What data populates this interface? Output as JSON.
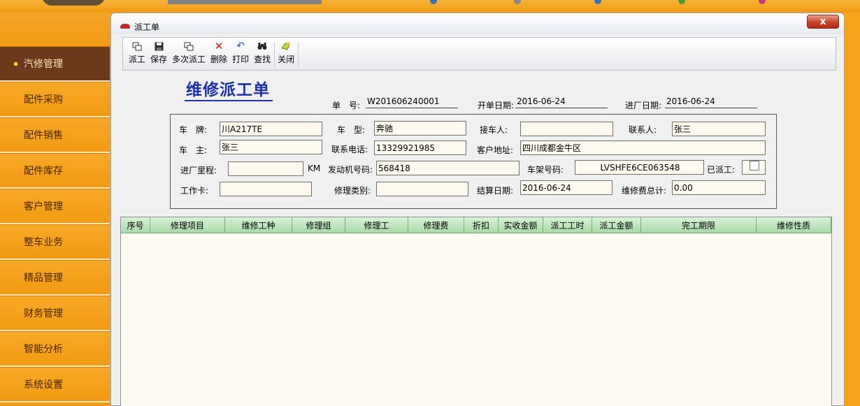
{
  "window": {
    "title": "派工单",
    "close_label": "x"
  },
  "sidebar": {
    "items": [
      {
        "label": "汽修管理",
        "active": true
      },
      {
        "label": "配件采购"
      },
      {
        "label": "配件销售"
      },
      {
        "label": "配件库存"
      },
      {
        "label": "客户管理"
      },
      {
        "label": "整车业务"
      },
      {
        "label": "精品管理"
      },
      {
        "label": "财务管理"
      },
      {
        "label": "智能分析"
      },
      {
        "label": "系统设置"
      }
    ]
  },
  "toolbar": {
    "buttons": [
      {
        "label": "派工",
        "icon": "dispatch-icon"
      },
      {
        "label": "保存",
        "icon": "save-icon"
      },
      {
        "label": "多次派工",
        "icon": "multi-dispatch-icon"
      },
      {
        "label": "删除",
        "icon": "delete-icon"
      },
      {
        "label": "打印",
        "icon": "print-icon"
      },
      {
        "label": "查找",
        "icon": "binoculars-icon"
      },
      {
        "label": "关闭",
        "icon": "close-icon"
      }
    ]
  },
  "form": {
    "heading": "维修派工单",
    "order_no_label": "单　号:",
    "order_no": "W201606240001",
    "open_date_label": "开单日期:",
    "open_date": "2016-06-24",
    "enter_date_label": "进厂日期:",
    "enter_date": "2016-06-24",
    "plate_label": "车　牌:",
    "plate": "川A217TE",
    "model_label": "车　型:",
    "model": "奔驰",
    "receiver_label": "接车人:",
    "receiver": "",
    "contact_label": "联系人:",
    "contact": "张三",
    "owner_label": "车　主:",
    "owner": "张三",
    "phone_label": "联系电话:",
    "phone": "13329921985",
    "address_label": "客户地址:",
    "address": "四川成都金牛区",
    "mileage_label": "进厂里程:",
    "mileage": "",
    "mileage_unit": "KM",
    "engine_label": "发动机号码:",
    "engine": "568418",
    "vin_label": "车架号码:",
    "vin": "LVSHFE6CE063548",
    "dispatched_label": "已派工:",
    "card_label": "工作卡:",
    "card": "",
    "repair_type_label": "修理类别:",
    "repair_type": "",
    "settle_date_label": "结算日期:",
    "settle_date": "2016-06-24",
    "total_label": "维修费总计:",
    "total": "0.00"
  },
  "grid": {
    "columns": [
      "序号",
      "修理项目",
      "维修工种",
      "修理组",
      "修理工",
      "修理费",
      "折扣",
      "实收金额",
      "派工工时",
      "派工金额",
      "完工期限",
      "维修性质"
    ]
  },
  "colors": {
    "sidebar_bg": "#f39a12",
    "sidebar_active": "#6b3a1a",
    "heading": "#1e2fa8",
    "grid_header": "#a9dba9",
    "input_bg": "#fdf9ef"
  }
}
